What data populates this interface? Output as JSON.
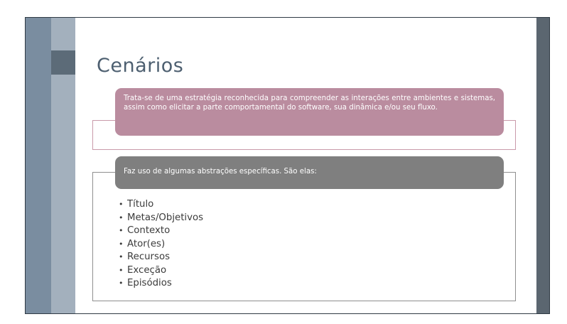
{
  "slide": {
    "title": "Cenários",
    "callout_definition": "Trata-se de uma estratégia reconhecida para compreender as interações entre ambientes e sistemas, assim como elicitar a parte comportamental do software, sua dinâmica e/ou seu fluxo.",
    "callout_abstractions": "Faz uso de algumas abstrações específicas. São elas:",
    "bullet_symbol": "•",
    "items": [
      {
        "label": "Título"
      },
      {
        "label": "Metas/Objetivos"
      },
      {
        "label": "Contexto"
      },
      {
        "label": "Ator(es)"
      },
      {
        "label": "Recursos"
      },
      {
        "label": "Exceção"
      },
      {
        "label": "Episódios"
      }
    ]
  },
  "colors": {
    "accent_pink": "#ba8c9f",
    "accent_gray": "#7f7f7f",
    "title_color": "#4d5f70",
    "sidebar_dark": "#7a8da0",
    "sidebar_light": "#a3b0bd",
    "right_bar": "#5b6670"
  }
}
